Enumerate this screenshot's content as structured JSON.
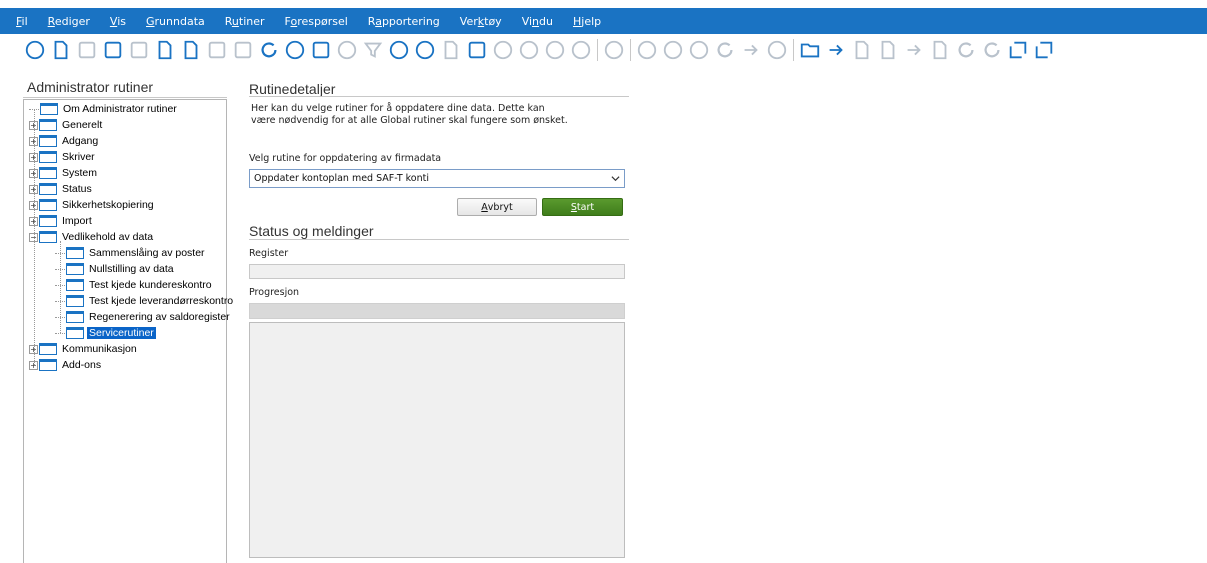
{
  "menu": [
    {
      "pre": "",
      "ul": "F",
      "post": "il"
    },
    {
      "pre": "",
      "ul": "R",
      "post": "ediger"
    },
    {
      "pre": "",
      "ul": "V",
      "post": "is"
    },
    {
      "pre": "",
      "ul": "G",
      "post": "runndata"
    },
    {
      "pre": "R",
      "ul": "u",
      "post": "tiner"
    },
    {
      "pre": "F",
      "ul": "o",
      "post": "respørsel"
    },
    {
      "pre": "R",
      "ul": "a",
      "post": "pportering"
    },
    {
      "pre": "Ver",
      "ul": "k",
      "post": "tøy"
    },
    {
      "pre": "Vi",
      "ul": "n",
      "post": "du"
    },
    {
      "pre": "",
      "ul": "H",
      "post": "jelp"
    }
  ],
  "toolbar_icons": [
    "info-icon",
    "new-document-icon",
    "save-icon",
    "delete-icon",
    "cut-icon",
    "copy-icon",
    "paste-icon",
    "print-icon",
    "preview-icon",
    "refresh-icon",
    "help-icon",
    "attachment-icon",
    "search-icon",
    "filter-icon",
    "history-icon",
    "globe-icon",
    "note-icon",
    "palette-icon",
    "first-icon",
    "previous-icon",
    "next-icon",
    "last-icon",
    "zoom-icon",
    "back-icon",
    "forward-icon",
    "stop-icon",
    "reload-icon",
    "home-icon",
    "find-icon",
    "open-folder-icon",
    "edit-sign-icon",
    "report-icon",
    "form-icon",
    "link-icon",
    "text-icon",
    "undo-icon",
    "redo-icon",
    "open-external-icon",
    "export-icon"
  ],
  "left_panel": {
    "title": "Administrator rutiner",
    "tree": [
      {
        "label": "Om Administrator rutiner",
        "level": 0,
        "expander": ""
      },
      {
        "label": "Generelt",
        "level": 0,
        "expander": "+"
      },
      {
        "label": "Adgang",
        "level": 0,
        "expander": "+"
      },
      {
        "label": "Skriver",
        "level": 0,
        "expander": "+"
      },
      {
        "label": "System",
        "level": 0,
        "expander": "+"
      },
      {
        "label": "Status",
        "level": 0,
        "expander": "+"
      },
      {
        "label": "Sikkerhetskopiering",
        "level": 0,
        "expander": "+"
      },
      {
        "label": "Import",
        "level": 0,
        "expander": "+"
      },
      {
        "label": "Vedlikehold av data",
        "level": 0,
        "expander": "-"
      },
      {
        "label": "Sammenslåing av poster",
        "level": 1,
        "expander": ""
      },
      {
        "label": "Nullstilling av data",
        "level": 1,
        "expander": ""
      },
      {
        "label": "Test kjede kundereskontro",
        "level": 1,
        "expander": ""
      },
      {
        "label": "Test kjede leverandørreskontro",
        "level": 1,
        "expander": ""
      },
      {
        "label": "Regenerering av saldoregister",
        "level": 1,
        "expander": ""
      },
      {
        "label": "Servicerutiner",
        "level": 1,
        "expander": "",
        "selected": true
      },
      {
        "label": "Kommunikasjon",
        "level": 0,
        "expander": "+"
      },
      {
        "label": "Add-ons",
        "level": 0,
        "expander": "+"
      }
    ]
  },
  "details": {
    "title": "Rutinedetaljer",
    "description": "Her kan du velge rutiner for å oppdatere dine data. Dette kan\n være nødvendig for at alle Global rutiner skal fungere som ønsket.",
    "select_label": "Velg rutine for oppdatering av firmadata",
    "select_value": "Oppdater kontoplan med SAF-T konti",
    "cancel": {
      "ul": "A",
      "post": "vbryt"
    },
    "start": {
      "ul": "S",
      "post": "tart"
    }
  },
  "status": {
    "title": "Status og meldinger",
    "register_label": "Register",
    "register_value": "",
    "progress_label": "Progresjon",
    "progress": 0,
    "log_text": ""
  },
  "colors": {
    "menubar": "#1a73c3",
    "icon_blue": "#1a73c3",
    "icon_gray": "#b9c2cc",
    "start_green": "#4a8a24",
    "selected": "#0a64c8"
  }
}
